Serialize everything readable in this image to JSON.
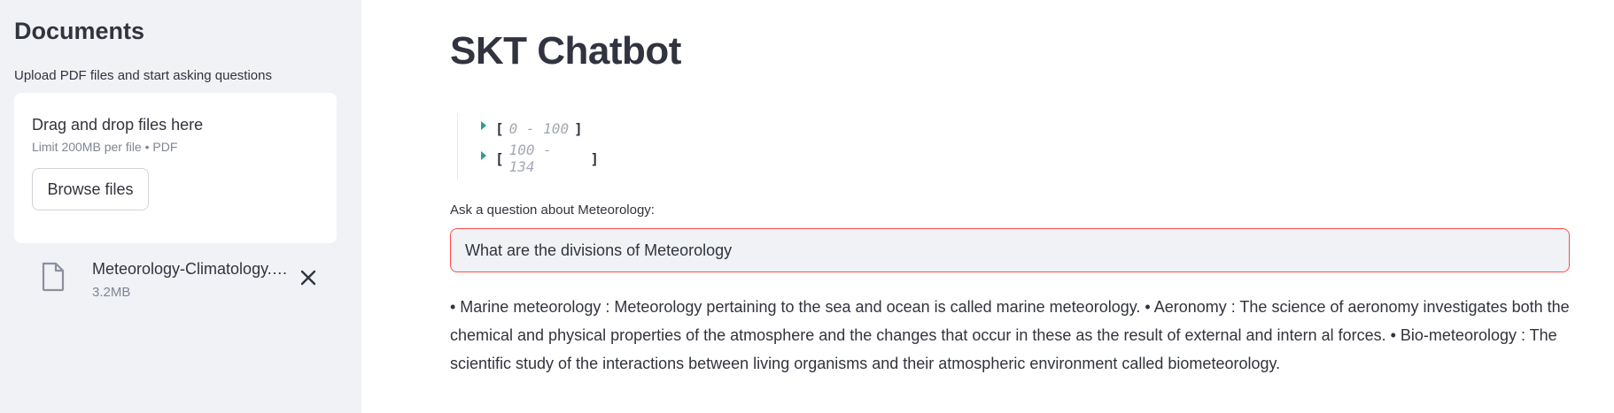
{
  "sidebar": {
    "title": "Documents",
    "caption": "Upload PDF files and start asking questions",
    "uploader": {
      "drop_text": "Drag and drop files here",
      "limit_text": "Limit 200MB per file • PDF",
      "browse_label": "Browse files"
    },
    "file": {
      "name": "Meteorology-Climatology.pdf",
      "size": "3.2MB",
      "icon": "file-icon",
      "remove_icon": "close-icon"
    }
  },
  "main": {
    "title": "SKT Chatbot",
    "json_rows": [
      {
        "open": "[",
        "range": "0 - 100",
        "close": "]"
      },
      {
        "open": "[",
        "range": "100 - 134",
        "close": "]"
      }
    ],
    "input_label": "Ask a question about Meteorology:",
    "input_value": "What are the divisions of Meteorology",
    "answer": "• Marine meteorology : Meteorology pertaining to the sea and ocean is called marine meteorology. • Aeronomy : The science of aeronomy investigates both the chemical and physical properties of the atmosphere and the changes that occur in these as the result of external and intern al forces. • Bio-meteorology : The scientific study of the interactions between living organisms and their atmospheric environment called biometeorology."
  },
  "colors": {
    "sidebar_bg": "#f0f2f6",
    "accent_red": "#ff4b4b",
    "caret_teal": "#2e9a93",
    "text": "#31333f"
  }
}
